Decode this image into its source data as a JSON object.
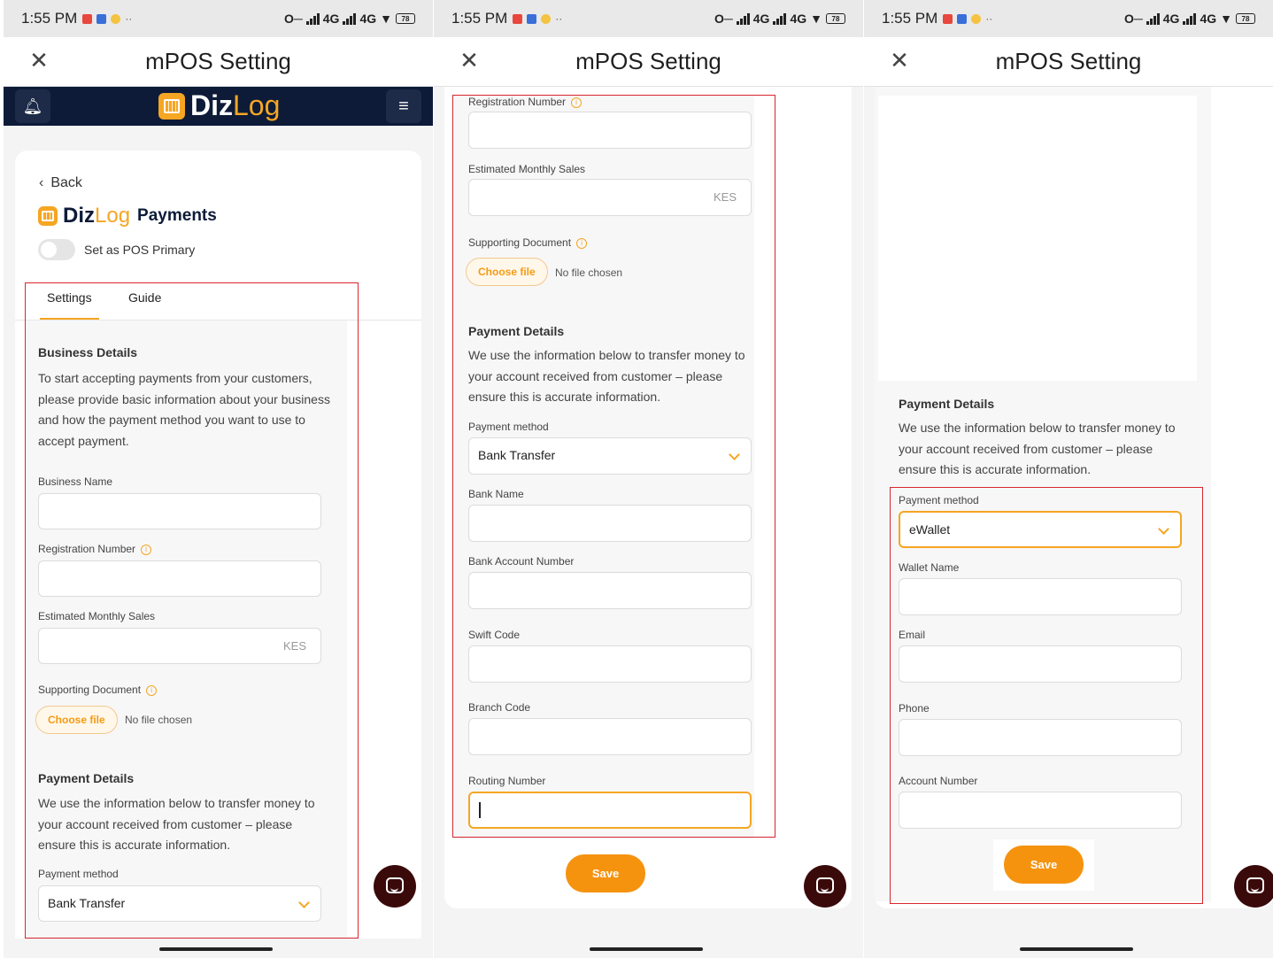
{
  "status": {
    "time": "1:55 PM",
    "network": "4G",
    "battery": "78"
  },
  "titlebar": {
    "title": "mPOS Setting"
  },
  "nav": {
    "brand_a": "Diz",
    "brand_b": "Log"
  },
  "page": {
    "back": "Back",
    "brand_a": "Diz",
    "brand_b": "Log",
    "brand_c": "Payments",
    "toggle_label": "Set as POS Primary",
    "tabs": [
      "Settings",
      "Guide"
    ]
  },
  "business": {
    "heading": "Business Details",
    "intro": "To start accepting payments from your customers, please provide basic information about your business and how the payment method you want to use to accept payment.",
    "business_name": "Business Name",
    "registration_number": "Registration Number",
    "monthly_sales": "Estimated Monthly Sales",
    "currency": "KES",
    "supporting_document": "Supporting Document",
    "choose_file": "Choose file",
    "no_file": "No file chosen"
  },
  "payment": {
    "heading": "Payment Details",
    "intro": "We use the information below to transfer money to your account received from customer – please ensure this is accurate information.",
    "method_label": "Payment method",
    "method_bank": "Bank Transfer",
    "method_wallet": "eWallet",
    "bank_name": "Bank Name",
    "bank_account_number": "Bank Account Number",
    "swift_code": "Swift Code",
    "branch_code": "Branch Code",
    "routing_number": "Routing Number",
    "wallet_name": "Wallet Name",
    "email": "Email",
    "phone": "Phone",
    "account_number": "Account Number",
    "save": "Save"
  }
}
